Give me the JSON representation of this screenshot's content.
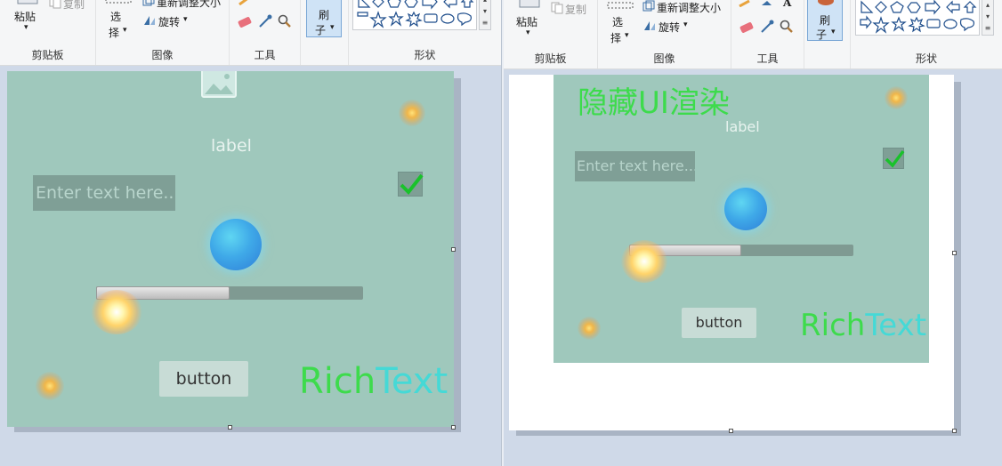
{
  "ribbon": {
    "clipboard": {
      "paste_label": "粘贴",
      "copy_label": "复制",
      "group_label": "剪贴板"
    },
    "image": {
      "select_label_top": "选",
      "select_label_bottom": "择",
      "resize_label": "重新调整大小",
      "rotate_label": "旋转",
      "group_label": "图像"
    },
    "tools": {
      "group_label": "工具"
    },
    "brush": {
      "label_top": "刷",
      "label_bottom": "子"
    },
    "shapes": {
      "group_label": "形状"
    }
  },
  "left_game": {
    "label_text": "label",
    "input_placeholder": "Enter text here...",
    "button_label": "button",
    "rich_text_a": "Rich",
    "rich_text_b": "Text",
    "progress": 0.5,
    "checked": true
  },
  "right_game": {
    "hidden_title": "隐藏UI渲染",
    "label_text": "label",
    "input_placeholder": "Enter text here...",
    "button_label": "button",
    "rich_text_a": "Rich",
    "rich_text_b": "Text",
    "progress": 0.5,
    "checked": true
  },
  "colors": {
    "game_bg": "#9fc8bc",
    "rich_green": "#3ddb4c",
    "rich_cyan": "#45d9d6",
    "ribbon_bg": "#f5f6f7"
  },
  "icons": [
    "paste-icon",
    "copy-icon",
    "select-icon",
    "resize-icon",
    "rotate-icon",
    "eraser-icon",
    "color-picker-icon",
    "magnifier-icon",
    "pencil-icon",
    "fill-icon",
    "text-icon",
    "brush-icon",
    "shapes-gallery-icon",
    "image-icon",
    "checkmark-icon"
  ]
}
